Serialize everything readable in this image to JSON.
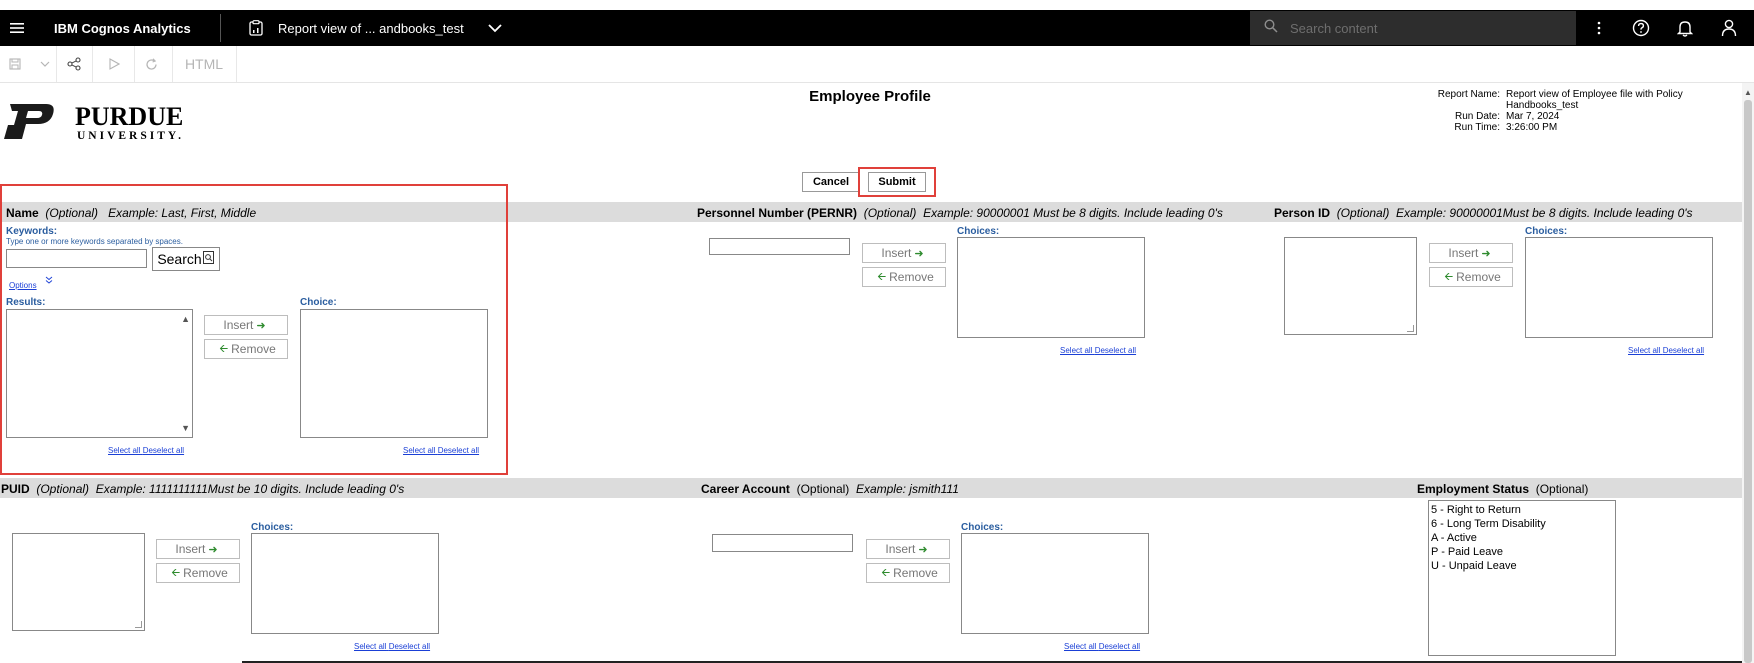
{
  "topbar": {
    "app_name": "IBM Cognos Analytics",
    "report_title": "Report view of ... andbooks_test",
    "search_placeholder": "Search content"
  },
  "toolbar": {
    "html_label": "HTML"
  },
  "report": {
    "title": "Employee Profile",
    "logo_text_main": "PURDUE",
    "logo_text_sub": "UNIVERSITY.",
    "meta_labels": {
      "name": "Report Name:",
      "date": "Run Date:",
      "time": "Run Time:"
    },
    "meta_values": {
      "name_line1": "Report view of Employee file with Policy",
      "name_line2": "Handbooks_test",
      "date": "Mar 7, 2024",
      "time": "3:26:00 PM"
    }
  },
  "actions": {
    "cancel": "Cancel",
    "submit": "Submit"
  },
  "common": {
    "insert": "Insert",
    "remove": "Remove",
    "choices": "Choices:",
    "select_all": "Select all",
    "deselect_all": "Deselect all"
  },
  "name_prompt": {
    "title": "Name",
    "optional": "(Optional)",
    "example": "Example: Last, First, Middle",
    "keywords_label": "Keywords:",
    "keywords_hint": "Type one or more keywords separated by spaces.",
    "search_button": "Search",
    "options": "Options",
    "results_label": "Results:",
    "choice_label": "Choice:"
  },
  "pernr_prompt": {
    "title": "Personnel Number (PERNR)",
    "optional": "(Optional)",
    "example": "Example:  90000001 Must be 8 digits.  Include leading 0's"
  },
  "personid_prompt": {
    "title": "Person ID",
    "optional": "(Optional)",
    "example": "Example:  90000001Must be 8 digits.  Include leading 0's"
  },
  "puid_prompt": {
    "title": "PUID",
    "optional": "(Optional)",
    "example": "Example:  1111111111Must be 10 digits.  Include leading 0's"
  },
  "career_prompt": {
    "title": "Career Account",
    "optional": "(Optional)",
    "example": "Example:  jsmith111"
  },
  "status_prompt": {
    "title": "Employment Status",
    "optional": "(Optional)",
    "options": [
      "5 - Right to Return",
      "6 - Long Term Disability",
      "A - Active",
      "P - Paid Leave",
      "U - Unpaid Leave"
    ]
  },
  "colors": {
    "highlight": "#e0403a",
    "band": "#dcdcdc",
    "label_blue": "#2a5d9f",
    "link_blue": "#1a3fd6"
  }
}
